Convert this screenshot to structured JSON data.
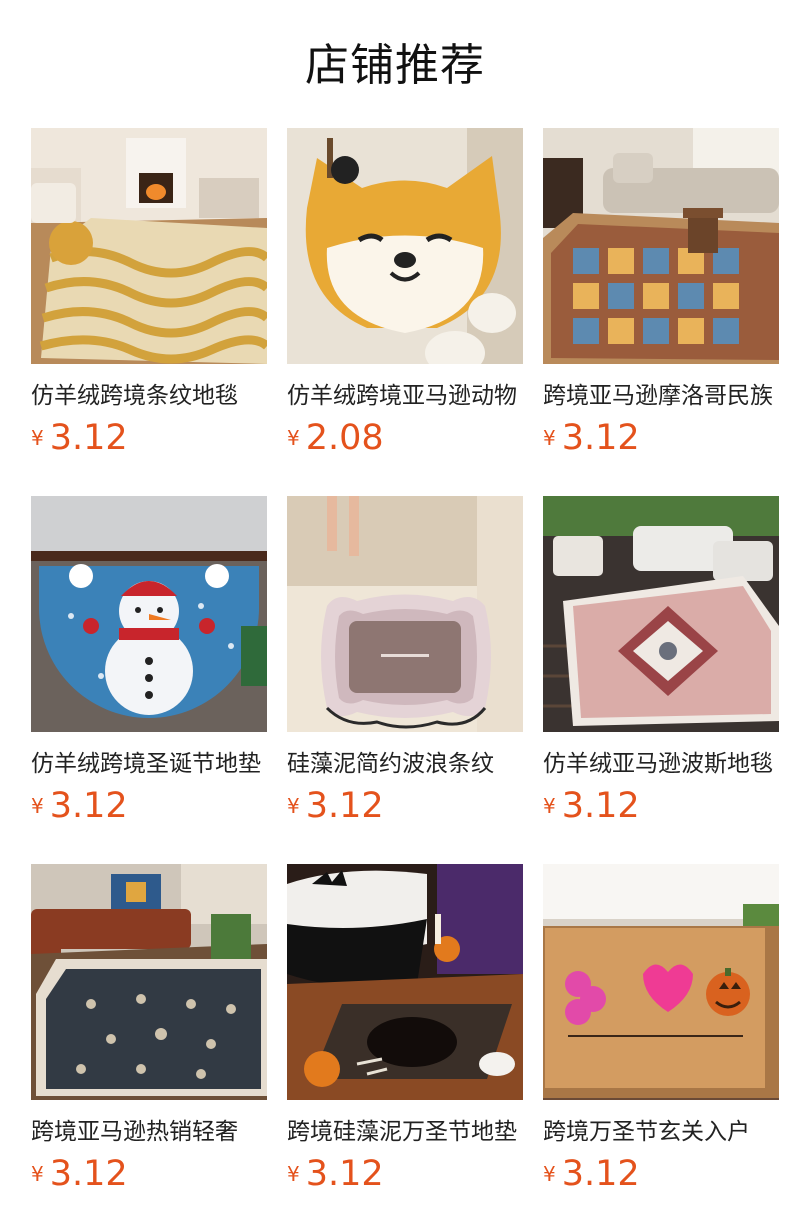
{
  "header": {
    "title": "店铺推荐"
  },
  "currency_symbol": "¥",
  "products": [
    {
      "name": "仿羊绒跨境条纹地毯",
      "price": "3.12",
      "image": "gold-wave-rug-living-room"
    },
    {
      "name": "仿羊绒跨境亚马逊动物",
      "price": "2.08",
      "image": "shiba-dog-bath-mat"
    },
    {
      "name": "跨境亚马逊摩洛哥民族",
      "price": "3.12",
      "image": "moroccan-patchwork-rug"
    },
    {
      "name": "仿羊绒跨境圣诞节地垫",
      "price": "3.12",
      "image": "snowman-half-round-mat"
    },
    {
      "name": "硅藻泥简约波浪条纹",
      "price": "3.12",
      "image": "wavy-diatomite-bath-mat"
    },
    {
      "name": "仿羊绒亚马逊波斯地毯",
      "price": "3.12",
      "image": "persian-rug-patio"
    },
    {
      "name": "跨境亚马逊热销轻奢",
      "price": "3.12",
      "image": "dark-floral-rug-living-room"
    },
    {
      "name": "跨境硅藻泥万圣节地垫",
      "price": "3.12",
      "image": "halloween-skeleton-bath-mat"
    },
    {
      "name": "跨境万圣节玄关入户",
      "price": "3.12",
      "image": "halloween-coir-doormat"
    }
  ]
}
